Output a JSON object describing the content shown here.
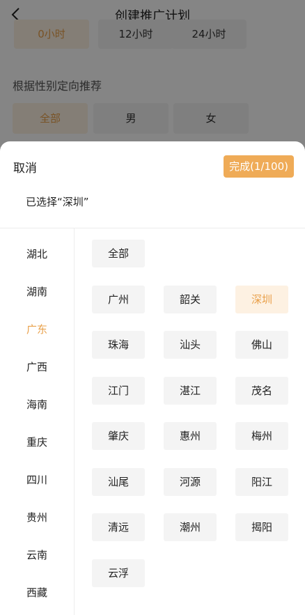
{
  "nav": {
    "title": "创建推广计划",
    "back_icon": "chevron-left-icon"
  },
  "time_options": [
    "0小时",
    "12小时",
    "24小时"
  ],
  "time_selected_index": 0,
  "gender_section_label": "根据性别定向推荐",
  "gender_options": [
    "全部",
    "男",
    "女"
  ],
  "gender_selected_index": 0,
  "sheet": {
    "cancel_label": "取消",
    "done_label": "完成(1/100)",
    "selected_text": "已选择“深圳”"
  },
  "provinces": [
    "湖北",
    "湖南",
    "广东",
    "广西",
    "海南",
    "重庆",
    "四川",
    "贵州",
    "云南",
    "西藏"
  ],
  "active_province": "广东",
  "cities": {
    "all_label": "全部",
    "items": [
      "广州",
      "韶关",
      "深圳",
      "珠海",
      "汕头",
      "佛山",
      "江门",
      "湛江",
      "茂名",
      "肇庆",
      "惠州",
      "梅州",
      "汕尾",
      "河源",
      "阳江",
      "清远",
      "潮州",
      "揭阳",
      "云浮"
    ],
    "selected": [
      "深圳"
    ]
  },
  "colors": {
    "accent": "#efab57",
    "accent_text": "#e9a04a",
    "accent_bg": "#fdf1e2"
  }
}
